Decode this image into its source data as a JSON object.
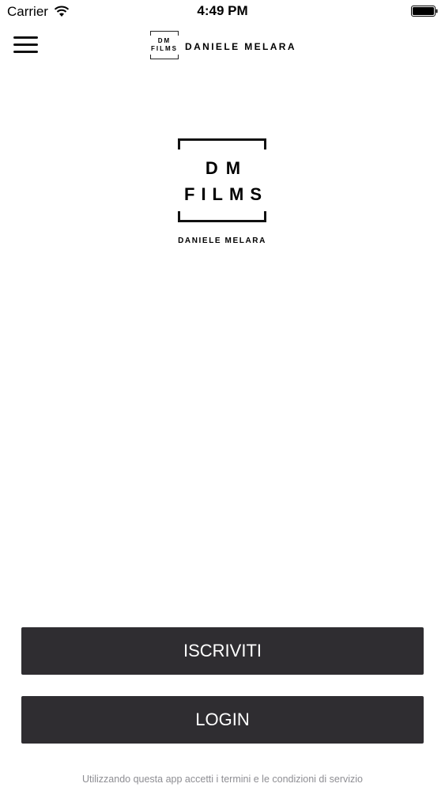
{
  "status_bar": {
    "carrier": "Carrier",
    "time": "4:49 PM",
    "wifi_icon": "wifi-icon",
    "battery_icon": "battery-icon"
  },
  "nav": {
    "menu_icon": "hamburger-menu-icon",
    "logo_line1": "DM",
    "logo_line2": "FILMS",
    "brand_name": "DANIELE MELARA"
  },
  "logo": {
    "line1": "DM",
    "line2": "FILMS",
    "name": "DANIELE MELARA"
  },
  "actions": {
    "signup_label": "ISCRIVITI",
    "login_label": "LOGIN"
  },
  "footer": {
    "terms_text": "Utilizzando questa app accetti i termini e le condizioni di servizio"
  },
  "colors": {
    "button_bg": "#2f2d31",
    "button_text": "#ffffff",
    "terms_text": "#8e8e93"
  }
}
